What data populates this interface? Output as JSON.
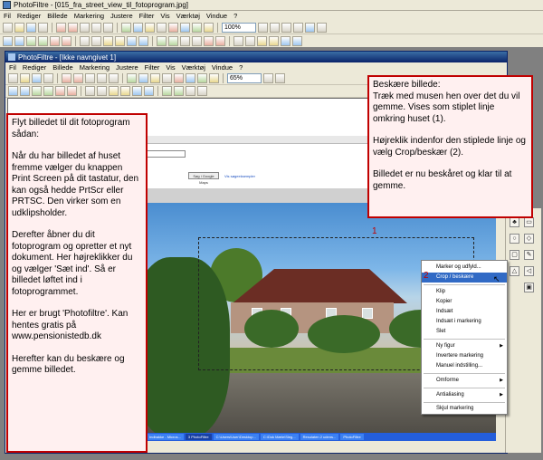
{
  "outer": {
    "title": "PhotoFiltre - [015_fra_street_view_til_fotoprogram.jpg]",
    "menu": [
      "Fil",
      "Rediger",
      "Billede",
      "Markering",
      "Justere",
      "Filter",
      "Vis",
      "Værktøj",
      "Vindue",
      "?"
    ],
    "zoom": "100%"
  },
  "inner": {
    "title": "PhotoFiltre - [Ikke navngivet 1]",
    "menu": [
      "Fil",
      "Rediger",
      "Billede",
      "Markering",
      "Justere",
      "Filter",
      "Vis",
      "Værktøj",
      "Vindue",
      "?"
    ],
    "zoom": "65%"
  },
  "browser": {
    "search_button": "Søg i Google Maps",
    "link": "Vis søgeeksempler"
  },
  "markers": {
    "one": "1",
    "two": "2"
  },
  "context_menu": [
    {
      "label": "Marker og udfyld...",
      "submenu": false
    },
    {
      "label": "Crop / beskære",
      "submenu": false,
      "highlighted": true
    },
    {
      "sep": true
    },
    {
      "label": "Klip",
      "submenu": false
    },
    {
      "label": "Kopier",
      "submenu": false
    },
    {
      "label": "Indsæt",
      "submenu": false
    },
    {
      "label": "Indsæt i markering",
      "submenu": false
    },
    {
      "label": "Slet",
      "submenu": false
    },
    {
      "sep": true
    },
    {
      "label": "Ny figur",
      "submenu": true
    },
    {
      "label": "Invertere markering",
      "submenu": false
    },
    {
      "label": "Manuel indstilling...",
      "submenu": false
    },
    {
      "sep": true
    },
    {
      "label": "Omforme",
      "submenu": true
    },
    {
      "sep": true
    },
    {
      "label": "Antialiasing",
      "submenu": true
    },
    {
      "sep": true
    },
    {
      "label": "Skjul markering",
      "submenu": false
    }
  ],
  "taskbar": [
    "Indbakke - Micros...",
    "3 PhotoFiltre",
    "C:\\Users\\User\\Desktop...",
    "C:\\Dok Mæle\\Sleg...",
    "Resulaten 2 udens...",
    "PhotoFiltre"
  ],
  "notes": {
    "left": [
      "Flyt billedet til dit fotoprogram sådan:",
      "Når du har billedet af huset fremme vælger du knappen Print Screen på dit tastatur, den kan også hedde PrtScr eller PRTSC. Den virker som en udklipsholder.",
      "Derefter åbner du dit fotoprogram og opretter et nyt dokument. Her højreklikker du og vælger 'Sæt ind'. Så er billedet løftet ind i fotoprogrammet.",
      "Her er brugt 'Photofiltre'. Kan hentes gratis på www.pensionistedb.dk",
      "Herefter kan du beskære og gemme billedet."
    ],
    "right": [
      "Beskære billede:\nTræk med musen hen over det du vil gemme. Vises som stiplet linje omkring huset (1).",
      "Højreklik indenfor den stiplede linje og vælg Crop/beskær (2).",
      "Billedet er nu beskåret og klar til at gemme."
    ]
  },
  "colors": {
    "annotation_border": "#c00000",
    "annotation_bg": "#fff0f0",
    "highlight": "#316ac5"
  }
}
